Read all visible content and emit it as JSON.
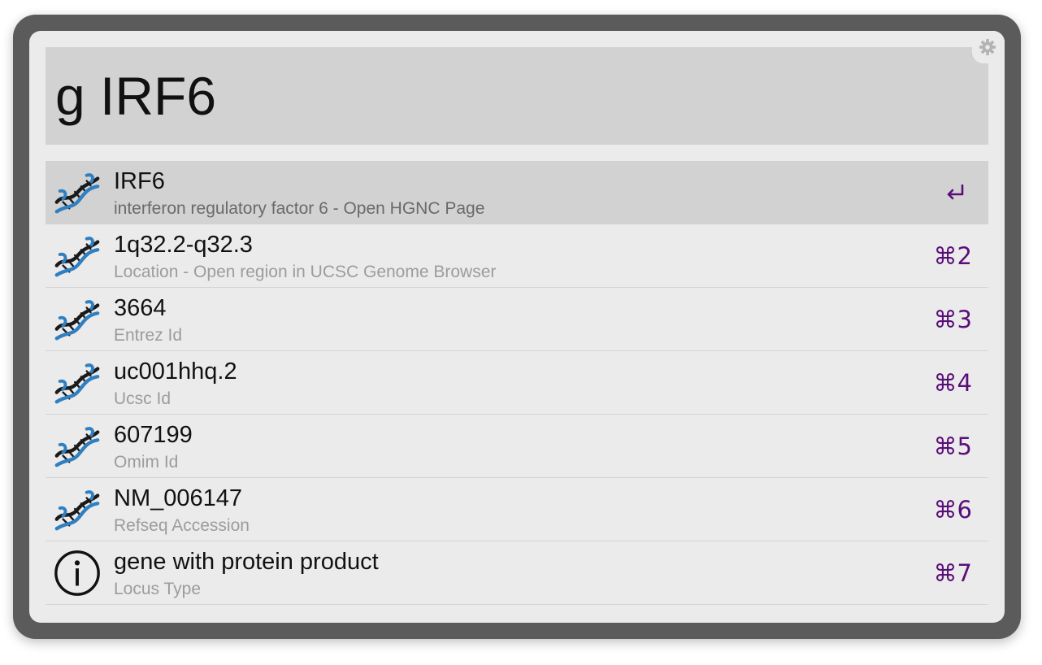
{
  "search": {
    "query": "g IRF6"
  },
  "icons": {
    "settings": "gear-icon",
    "dna": "dna-icon",
    "info": "info-icon",
    "return": "return-key-icon"
  },
  "colors": {
    "shortcut": "#5a0e7a",
    "dna_blue": "#2f7fc1",
    "dna_dark": "#1a1a1a",
    "selected_row": "#d2d2d2"
  },
  "results": [
    {
      "title": "IRF6",
      "subtitle": "interferon regulatory factor 6 - Open HGNC Page",
      "shortcut": "↩",
      "icon": "dna-icon",
      "selected": true
    },
    {
      "title": "1q32.2-q32.3",
      "subtitle": "Location - Open region in UCSC Genome Browser",
      "shortcut": "⌘2",
      "icon": "dna-icon"
    },
    {
      "title": "3664",
      "subtitle": "Entrez Id",
      "shortcut": "⌘3",
      "icon": "dna-icon"
    },
    {
      "title": "uc001hhq.2",
      "subtitle": "Ucsc Id",
      "shortcut": "⌘4",
      "icon": "dna-icon"
    },
    {
      "title": "607199",
      "subtitle": "Omim Id",
      "shortcut": "⌘5",
      "icon": "dna-icon"
    },
    {
      "title": "NM_006147",
      "subtitle": "Refseq Accession",
      "shortcut": "⌘6",
      "icon": "dna-icon"
    },
    {
      "title": "gene with protein product",
      "subtitle": "Locus Type",
      "shortcut": "⌘7",
      "icon": "info-icon"
    }
  ]
}
